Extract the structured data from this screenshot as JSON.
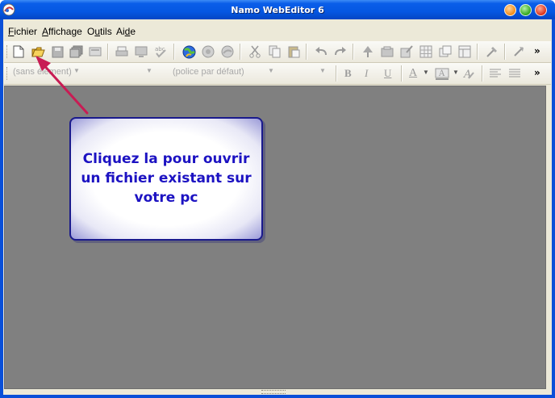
{
  "window": {
    "title": "Namo WebEditor 6"
  },
  "menu": {
    "items": [
      "Fichier",
      "Affichage",
      "Outils",
      "Aide"
    ],
    "underlined": [
      "F",
      "A",
      "u",
      "d"
    ]
  },
  "format_toolbar": {
    "style_combo": "(sans élément)",
    "font_combo": "(police par défaut)",
    "bold": "B",
    "italic": "I",
    "underline": "U",
    "text_color": "A"
  },
  "toolbar": {
    "overflow": "»"
  },
  "callout": {
    "lines": [
      "Cliquez la pour ouvrir",
      "un fichier existant sur",
      "votre pc"
    ]
  },
  "colors": {
    "accent": "#0a4fd8",
    "callout_text": "#1c12c2",
    "arrow": "#c81c54",
    "editor_bg": "#808080"
  },
  "icons": [
    "new-document-icon",
    "open-folder-icon",
    "save-icon",
    "save-all-icon",
    "print-preview-icon",
    "print-icon",
    "preview-icon",
    "spellcheck-icon",
    "publish-globe-icon",
    "browser-preview-icon",
    "site-icon",
    "cut-icon",
    "copy-icon",
    "paste-icon",
    "undo-icon",
    "redo-icon",
    "insert-image-icon",
    "insert-form-icon",
    "insert-object-icon",
    "insert-table-icon",
    "insert-layer-icon",
    "insert-frame-icon",
    "tools-icon",
    "hyperlink-icon"
  ]
}
